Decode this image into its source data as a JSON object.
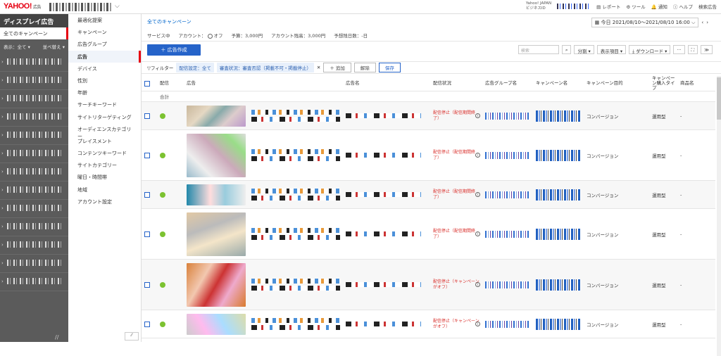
{
  "header": {
    "logo": "YAHOO!",
    "logo_sub": "広告",
    "logo_japan": "JAPAN",
    "biz_id_line1": "Yahoo! JAPAN",
    "biz_id_line2": "ビジネスID",
    "links": {
      "report": "レポート",
      "tools": "ツール",
      "notify": "通知",
      "help": "ヘルプ",
      "search_ads": "検索広告"
    }
  },
  "left_nav": {
    "title": "ディスプレイ広告",
    "selected": "全てのキャンペーン",
    "filter_display": "表示：全て ▾",
    "filter_sort": "並べ替え ▾",
    "campaign_count": 13
  },
  "sub_nav": {
    "items": [
      "最適化提案",
      "キャンペーン",
      "広告グループ",
      "広告",
      "デバイス",
      "性別",
      "年齢",
      "サーチキーワード",
      "サイトリターゲティング",
      "オーディエンスカテゴリー",
      "プレイスメント",
      "コンテンツキーワード",
      "サイトカテゴリー",
      "曜日・時間帯",
      "地域",
      "アカウント設定"
    ],
    "active_index": 3,
    "collapse": "//"
  },
  "main": {
    "breadcrumb": "全てのキャンペーン",
    "date_range": "今日 2021/08/10〜2021/08/10 16:00",
    "summary": {
      "service": "サービス中",
      "account": "アカウント：",
      "account_state": "オフ",
      "budget": "予算：3,000円",
      "remaining": "アカウント残高：3,000円",
      "days": "予想残日数：-日"
    },
    "create_button": "＋ 広告作成",
    "search_placeholder": "検索",
    "tools": {
      "segment": "分割 ▾",
      "columns": "表示項目 ▾",
      "download": "⤓ ダウンロード ▾",
      "more": "···",
      "expand": "⛶",
      "collapse": "≫"
    }
  },
  "filters": {
    "label": "▽フィルター",
    "chips": [
      "配信設定：全て",
      "審査状況：審査否認（掲載不可・掲載停止）"
    ],
    "add": "＋ 追加",
    "clear": "解除",
    "save": "保存"
  },
  "table": {
    "columns": [
      "",
      "配信",
      "広告",
      "",
      "広告名",
      "配信状況",
      "広告グループ名",
      "キャンペーン名",
      "キャンペーン目的",
      "キャンペーン購入タイプ",
      "商品名"
    ],
    "total_label": "合計",
    "rows": [
      {
        "status": "配信停止（配信期間終了）",
        "objective": "コンバージョン",
        "buy_type": "運用型",
        "product": "-"
      },
      {
        "status": "配信停止（配信期間終了）",
        "objective": "コンバージョン",
        "buy_type": "運用型",
        "product": "-"
      },
      {
        "status": "配信停止（配信期間終了）",
        "objective": "コンバージョン",
        "buy_type": "運用型",
        "product": "-"
      },
      {
        "status": "配信停止（配信期間終了）",
        "objective": "コンバージョン",
        "buy_type": "運用型",
        "product": "-"
      },
      {
        "status": "配信停止（キャンペーンがオフ）",
        "objective": "コンバージョン",
        "buy_type": "運用型",
        "product": "-"
      },
      {
        "status": "配信停止（キャンペーンがオフ）",
        "objective": "コンバージョン",
        "buy_type": "運用型",
        "product": "-"
      }
    ]
  },
  "colors": {
    "accent": "#2563c9",
    "brand": "#e60012",
    "stop_status": "#d9302c",
    "active_dot": "#7cc231",
    "sidebar": "#5b5b5b"
  }
}
